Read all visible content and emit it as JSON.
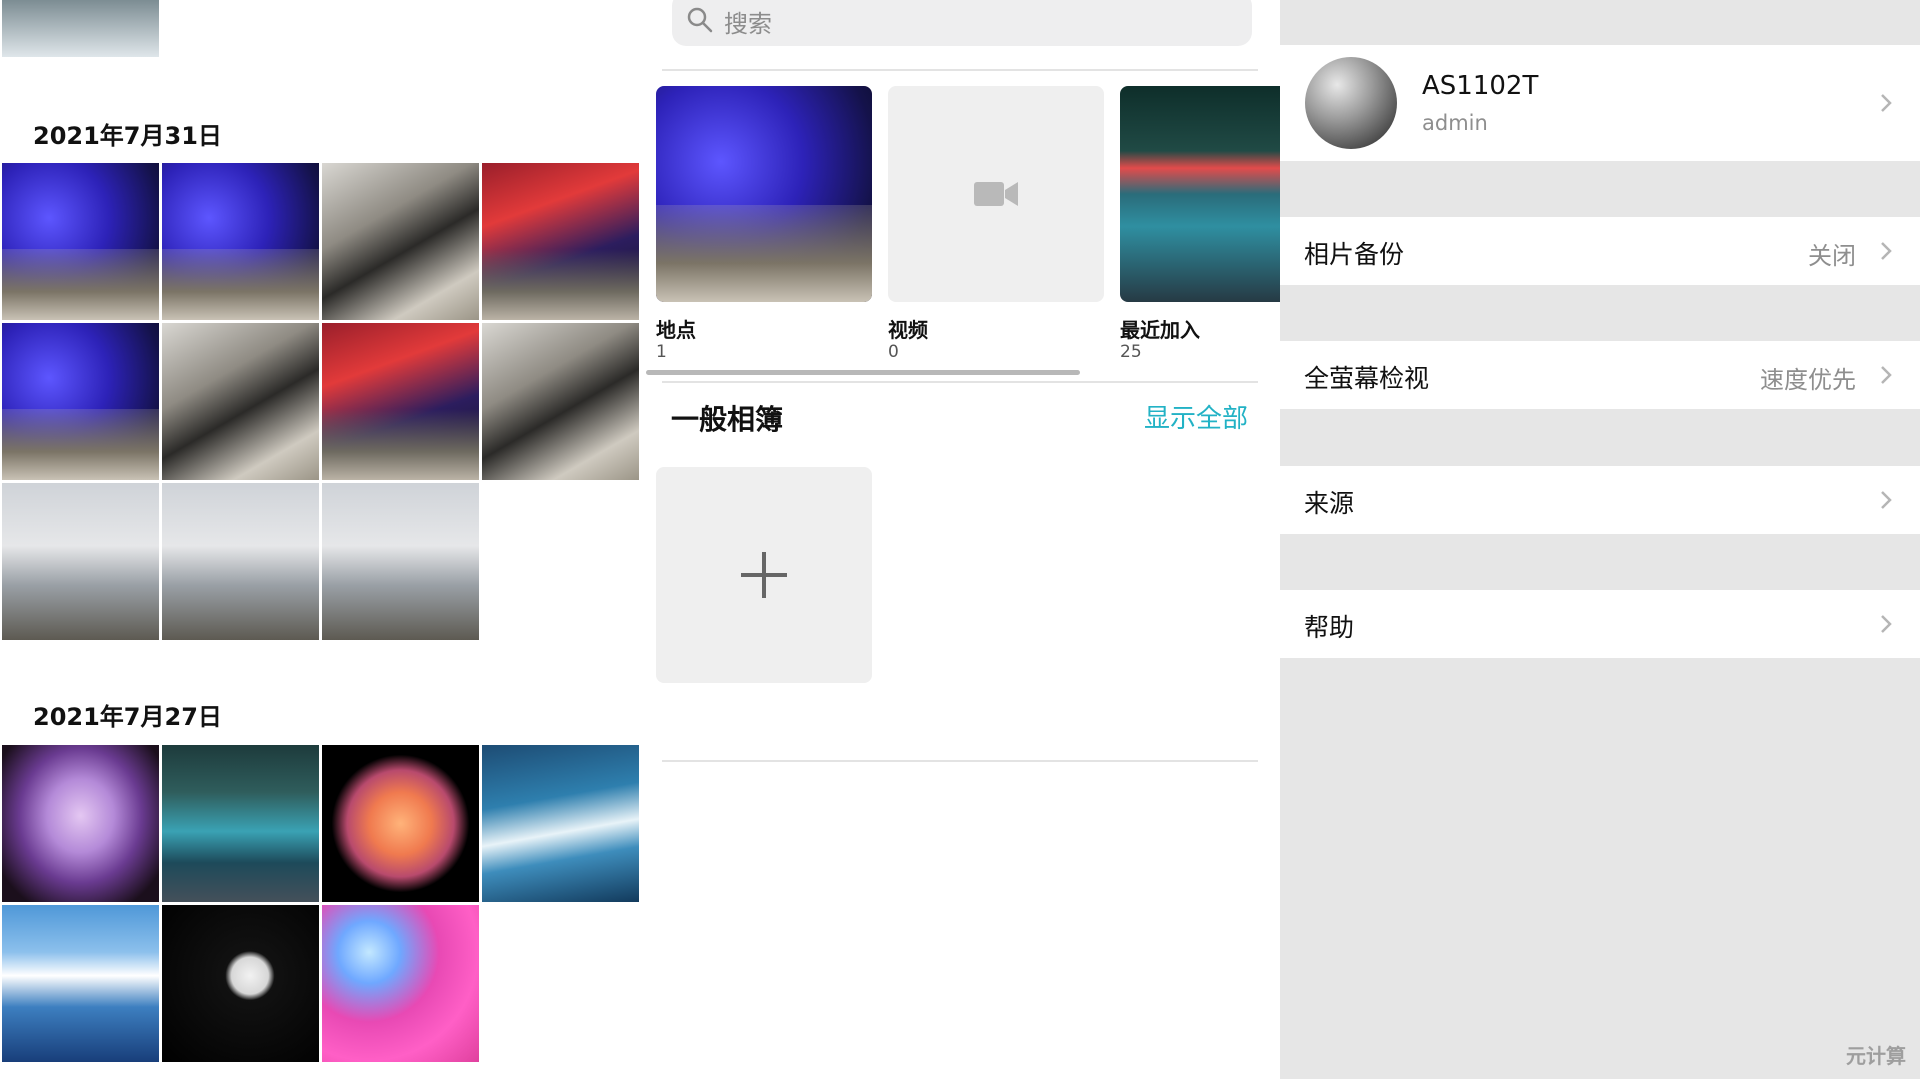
{
  "photos": {
    "section_1_date": "2021年7月31日",
    "section_2_date": "2021年7月27日"
  },
  "albums": {
    "search_placeholder": "搜索",
    "media_types": [
      {
        "name": "地点",
        "count": "1"
      },
      {
        "name": "视频",
        "count": "0"
      },
      {
        "name": "最近加入",
        "count": "25"
      }
    ],
    "general_albums_title": "一般相簿",
    "show_all_label": "显示全部",
    "accent_color": "#22b2c5"
  },
  "settings": {
    "account": {
      "name": "AS1102T",
      "role": "admin"
    },
    "items": [
      {
        "label": "相片备份",
        "value": "关闭"
      },
      {
        "label": "全萤幕检视",
        "value": "速度优先"
      },
      {
        "label": "来源",
        "value": ""
      },
      {
        "label": "帮助",
        "value": ""
      }
    ]
  },
  "watermark": "元计算"
}
